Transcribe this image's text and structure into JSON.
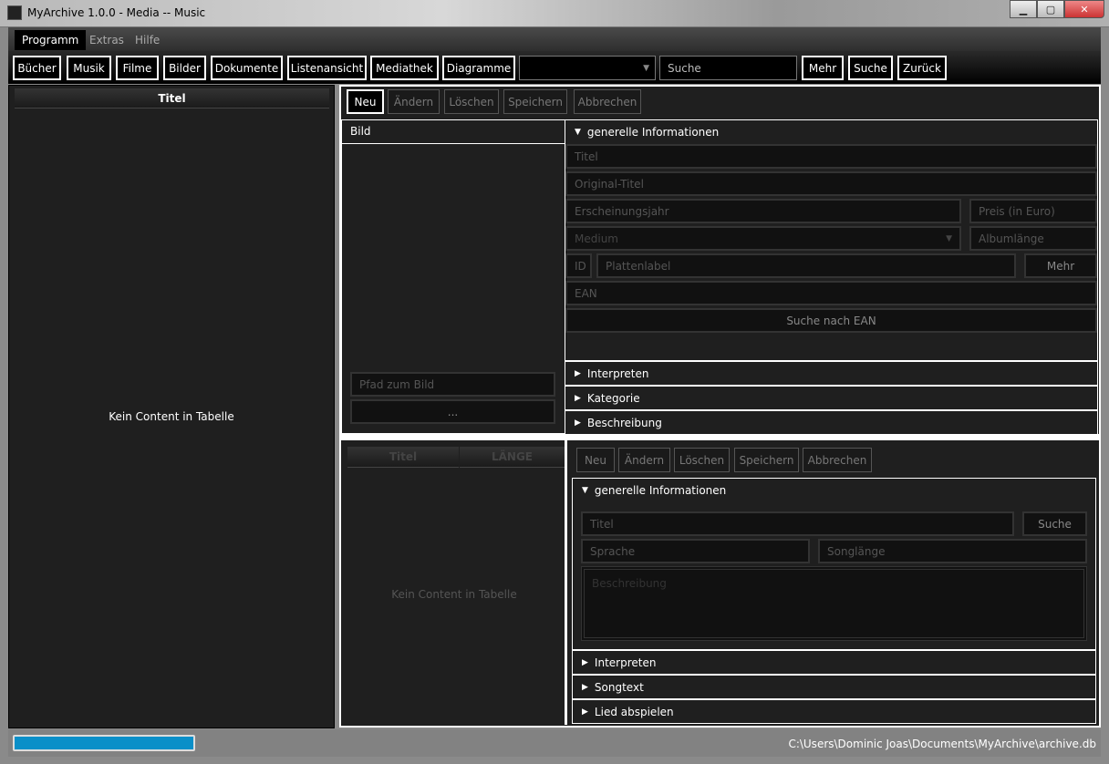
{
  "window": {
    "title": "MyArchive 1.0.0 - Media -- Music",
    "minimize": "▁",
    "maximize": "▢",
    "close": "✕"
  },
  "menu": [
    "Programm",
    "Extras",
    "Hilfe"
  ],
  "toolbar": {
    "buttons": [
      "Bücher",
      "Musik",
      "Filme",
      "Bilder",
      "Dokumente",
      "Listenansicht",
      "Mediathek",
      "Diagramme"
    ],
    "combo_value": "",
    "combo_arrow": "▼",
    "search_placeholder": "Suche",
    "mehr": "Mehr",
    "suche": "Suche",
    "zurueck": "Zurück"
  },
  "left": {
    "header": "Titel",
    "empty": "Kein Content in Tabelle"
  },
  "actions": [
    "Neu",
    "Ändern",
    "Löschen",
    "Speichern",
    "Abbrechen"
  ],
  "album": {
    "bild_header": "Bild",
    "path_placeholder": "Pfad zum Bild",
    "browse": "...",
    "general": "generelle Informationen",
    "fields": {
      "titel": "Titel",
      "original": "Original-Titel",
      "jahr": "Erscheinungsjahr",
      "preis": "Preis (in Euro)",
      "medium": "Medium",
      "albumlaenge": "Albumlänge",
      "id": "ID",
      "label": "Plattenlabel",
      "mehr": "Mehr",
      "ean": "EAN",
      "ean_search": "Suche nach EAN"
    },
    "sections": [
      "Interpreten",
      "Kategorie",
      "Beschreibung"
    ]
  },
  "songs": {
    "columns": [
      "Titel",
      "LÄNGE"
    ],
    "empty": "Kein Content in Tabelle",
    "general": "generelle Informationen",
    "fields": {
      "titel": "Titel",
      "suche": "Suche",
      "sprache": "Sprache",
      "songlaenge": "Songlänge",
      "beschreibung": "Beschreibung"
    },
    "sections": [
      "Interpreten",
      "Songtext",
      "Lied abspielen"
    ]
  },
  "status": {
    "progress": 1.0,
    "path": "C:\\Users\\Dominic Joas\\Documents\\MyArchive\\archive.db"
  },
  "icons": {
    "expanded": "▼",
    "collapsed": "▶"
  }
}
